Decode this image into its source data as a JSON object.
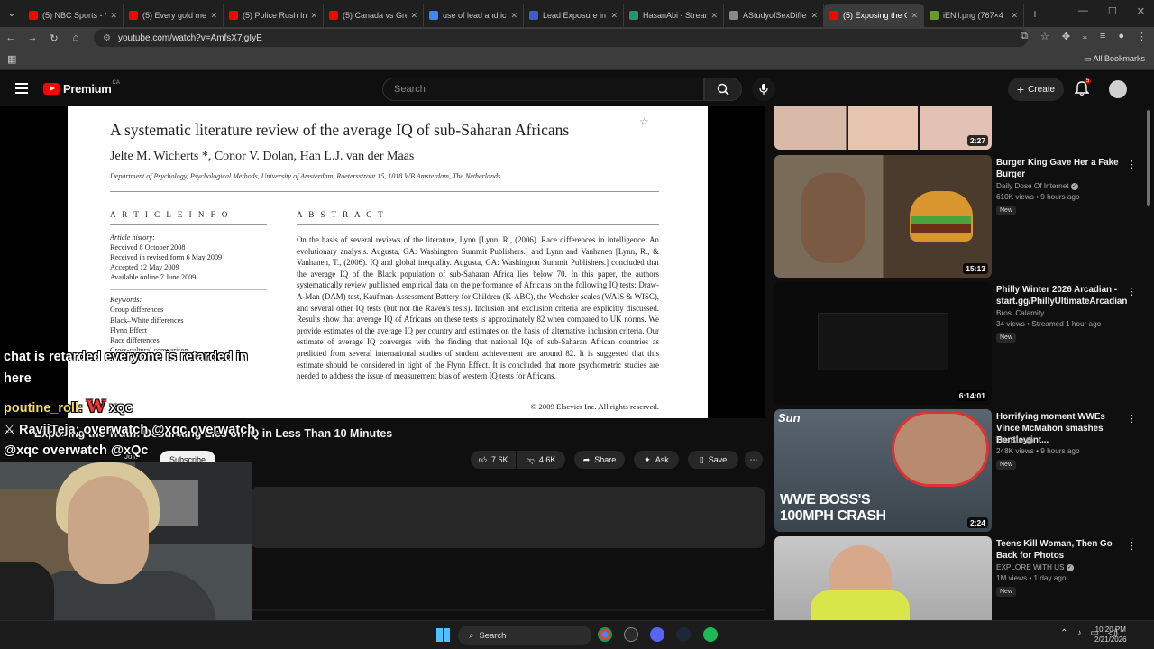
{
  "browser": {
    "tabs": [
      {
        "title": "(5) NBC Sports - Y",
        "color": "#ff0000",
        "active": false
      },
      {
        "title": "(5) Every gold me",
        "color": "#ff0000",
        "active": false
      },
      {
        "title": "(5) Police Rush In",
        "color": "#ff0000",
        "active": false
      },
      {
        "title": "(5) Canada vs Gre",
        "color": "#ff0000",
        "active": false
      },
      {
        "title": "use of lead and ic",
        "color": "#4285f4",
        "active": false
      },
      {
        "title": "Lead Exposure in",
        "color": "#3b5bdb",
        "active": false
      },
      {
        "title": "HasanAbi - Stream",
        "color": "#1d9a6c",
        "active": false
      },
      {
        "title": "AStudyofSexDiffe",
        "color": "#888888",
        "active": false
      },
      {
        "title": "(5) Exposing the G",
        "color": "#ff0000",
        "active": true
      },
      {
        "title": "iENjl.png (767×4",
        "color": "#6a9a2a",
        "active": false
      }
    ],
    "url": "youtube.com/watch?v=AmfsX7jgIyE",
    "all_bookmarks": "All Bookmarks"
  },
  "youtube": {
    "logo_text": "Premium",
    "region": "CA",
    "search_placeholder": "Search",
    "create_label": "Create",
    "notif_count": "5"
  },
  "paper": {
    "title": "A systematic literature review of the average IQ of sub-Saharan Africans",
    "star": "☆",
    "authors": "Jelte M. Wicherts *, Conor V. Dolan, Han L.J. van der Maas",
    "affiliation": "Department of Psychology, Psychological Methods, University of Amsterdam, Roetersstraat 15, 1018 WB Amsterdam, The Netherlands",
    "article_info_heading": "A R T I C L E   I N F O",
    "abstract_heading": "A B S T R A C T",
    "history_label": "Article history:",
    "history": [
      "Received 8 October 2008",
      "Received in revised form 6 May 2009",
      "Accepted 12 May 2009",
      "Available online 7 June 2009"
    ],
    "keywords_label": "Keywords:",
    "keywords": [
      "Group differences",
      "Black–White differences",
      "Flynn Effect",
      "Race differences",
      "Cross-cultural comparison"
    ],
    "abstract": "On the basis of several reviews of the literature, Lynn [Lynn, R., (2006). Race differences in intelligence: An evolutionary analysis. Augusta, GA: Washington Summit Publishers.] and Lynn and Vanhanen [Lynn, R., & Vanhanen, T., (2006). IQ and global inequality. Augusta, GA: Washington Summit Publishers.] concluded that the average IQ of the Black population of sub-Saharan Africa lies below 70. In this paper, the authors systematically review published empirical data on the performance of Africans on the following IQ tests: Draw-A-Man (DAM) test, Kaufman-Assessment Battery for Children (K-ABC), the Wechsler scales (WAIS & WISC), and several other IQ tests (but not the Raven's tests). Inclusion and exclusion criteria are explicitly discussed. Results show that average IQ of Africans on these tests is approximately 82 when compared to UK norms. We provide estimates of the average IQ per country and estimates on the basis of alternative inclusion criteria. Our estimate of average IQ converges with the finding that national IQs of sub-Saharan African countries as predicted from several international studies of student achievement are around 82. It is suggested that this estimate should be considered in light of the Flynn Effect. It is concluded that more psychometric studies are needed to address the issue of measurement bias of western IQ tests for Africans.",
    "copyright": "© 2009 Elsevier Inc. All rights reserved."
  },
  "video": {
    "title": "Exposing the Truth: Debunking Lies on IQ in Less Than 10 Minutes",
    "join_label": "Join",
    "subscribe_label": "Subscribe",
    "likes": "7.6K",
    "dislikes": "4.6K",
    "share_label": "Share",
    "ask_label": "Ask",
    "save_label": "Save"
  },
  "chat": {
    "line1": "chat is retarded everyone is retarded in",
    "line2": "here",
    "user1": "poutine_roll:",
    "user1_msg_w": "W",
    "user1_msg": "XQC",
    "user2": "RaviiTeja:",
    "user2_msg": "overwatch @xqc overwatch",
    "line5": "@xqc overwatch @xQc"
  },
  "recommendations": [
    {
      "title": "",
      "channel": "",
      "meta": "",
      "badge": "",
      "duration": "2:27"
    },
    {
      "title": "Burger King Gave Her a Fake Burger",
      "channel": "Daily Dose Of Internet",
      "meta": "610K views • 9 hours ago",
      "badge": "New",
      "duration": "15:13"
    },
    {
      "title": "Philly Winter 2026 Arcadian - start.gg/PhillyUltimateArcadian",
      "channel": "Bros. Calamity",
      "meta": "34 views • Streamed 1 hour ago",
      "badge": "New",
      "duration": "6:14:01"
    },
    {
      "title": "Horrifying moment WWEs Vince McMahon smashes Bentley int...",
      "channel": "The Sun",
      "meta": "248K views • 9 hours ago",
      "badge": "New",
      "duration": "2:24",
      "thumb_brand": "Sun",
      "thumb_caption1": "WWE BOSS'S",
      "thumb_caption2": "100MPH CRASH"
    },
    {
      "title": "Teens Kill Woman, Then Go Back for Photos",
      "channel": "EXPLORE WITH US",
      "meta": "1M views • 1 day ago",
      "badge": "New",
      "duration": ""
    }
  ],
  "taskbar": {
    "search_label": "Search",
    "time": "10:20 PM",
    "date": "2/21/2026"
  }
}
